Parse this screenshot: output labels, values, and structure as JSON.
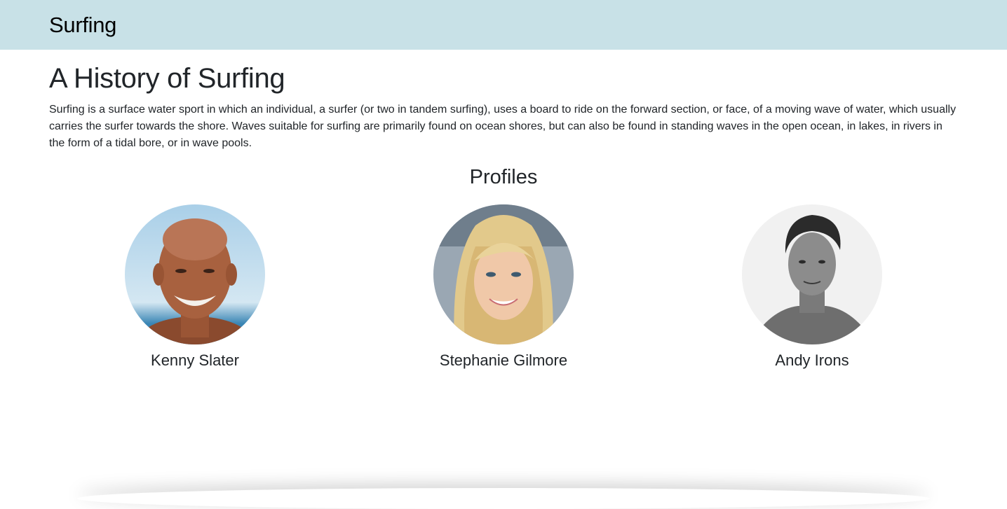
{
  "navbar": {
    "brand": "Surfing"
  },
  "main": {
    "title": "A History of Surfing",
    "intro": "Surfing is a surface water sport in which an individual, a surfer (or two in tandem surfing), uses a board to ride on the forward section, or face, of a moving wave of water, which usually carries the surfer towards the shore. Waves suitable for surfing are primarily found on ocean shores, but can also be found in standing waves in the open ocean, in lakes, in rivers in the form of a tidal bore, or in wave pools.",
    "profiles_heading": "Profiles",
    "profiles": [
      {
        "name": "Kenny Slater",
        "avatar": "photo-bald-man-beach"
      },
      {
        "name": "Stephanie Gilmore",
        "avatar": "photo-blonde-woman"
      },
      {
        "name": "Andy Irons",
        "avatar": "photo-man-grayscale"
      }
    ]
  }
}
